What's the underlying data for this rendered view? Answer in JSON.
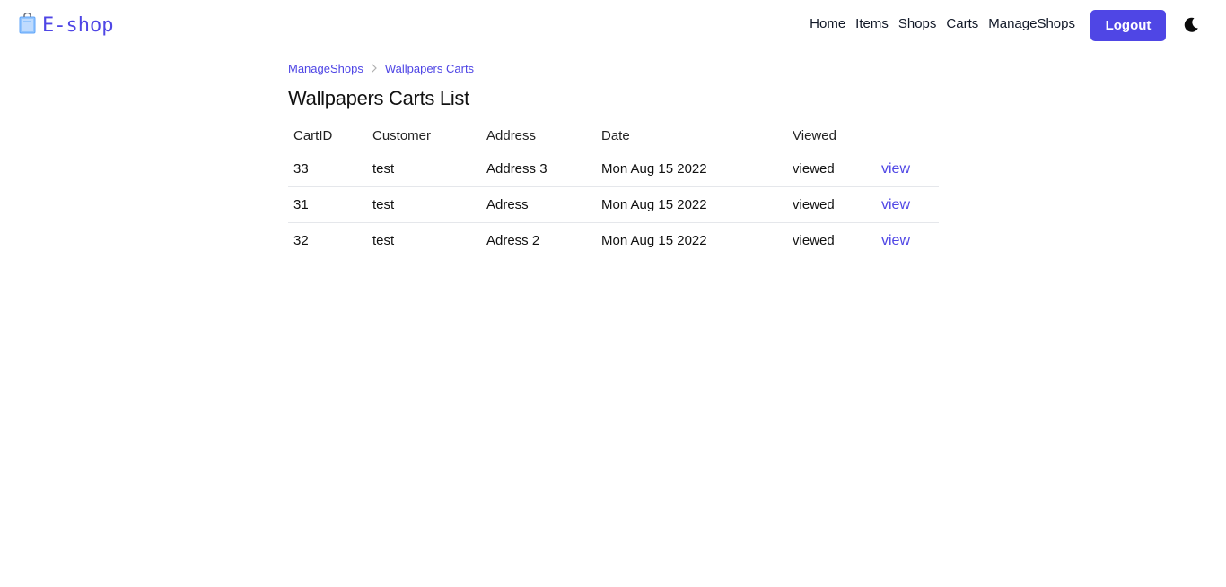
{
  "brand": {
    "icon": "shopping-bag-icon",
    "name": "E-shop",
    "color": "#4f46e5"
  },
  "nav": {
    "links": [
      "Home",
      "Items",
      "Shops",
      "Carts",
      "ManageShops"
    ],
    "logout_label": "Logout",
    "theme_icon": "moon-icon"
  },
  "breadcrumb": {
    "items": [
      "ManageShops",
      "Wallpapers Carts"
    ],
    "separator_icon": "chevron-right-icon"
  },
  "page": {
    "title": "Wallpapers Carts List"
  },
  "table": {
    "headers": [
      "CartID",
      "Customer",
      "Address",
      "Date",
      "Viewed",
      ""
    ],
    "rows": [
      {
        "cart_id": "33",
        "customer": "test",
        "address": "Address 3",
        "date": "Mon Aug 15 2022",
        "viewed": "viewed",
        "action": "view"
      },
      {
        "cart_id": "31",
        "customer": "test",
        "address": "Adress",
        "date": "Mon Aug 15 2022",
        "viewed": "viewed",
        "action": "view"
      },
      {
        "cart_id": "32",
        "customer": "test",
        "address": "Adress 2",
        "date": "Mon Aug 15 2022",
        "viewed": "viewed",
        "action": "view"
      }
    ]
  },
  "colors": {
    "accent": "#4f46e5",
    "text": "#111111",
    "divider": "#e5e7eb"
  }
}
